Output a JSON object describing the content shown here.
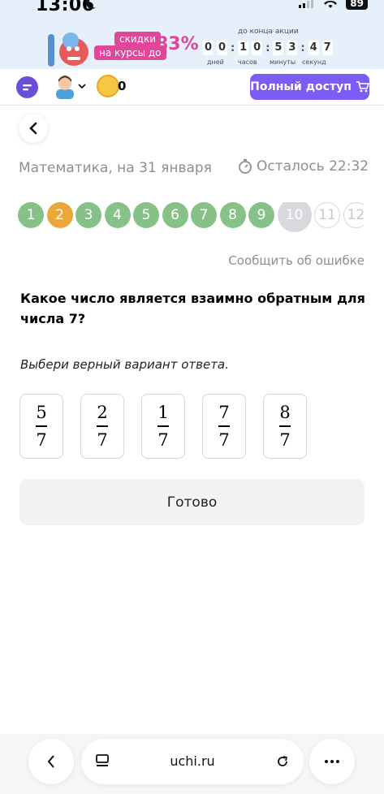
{
  "status": {
    "time": "13:06",
    "battery": "89"
  },
  "promo": {
    "pill1": "скидки",
    "pill2": "на курсы до",
    "percent": "83%",
    "caption": "до конца акции",
    "digits": [
      "0",
      "0",
      "1",
      "0",
      "5",
      "3",
      "4",
      "7"
    ],
    "labels": [
      "дней",
      "часов",
      "минуты",
      "секунд"
    ]
  },
  "topbar": {
    "coins": "0",
    "access_label": "Полный доступ"
  },
  "header": {
    "subject": "Математика, на 31 января",
    "time_left": "Осталось 22:32"
  },
  "steps": [
    {
      "label": "1",
      "state": "done"
    },
    {
      "label": "2",
      "state": "current"
    },
    {
      "label": "3",
      "state": "done"
    },
    {
      "label": "4",
      "state": "done"
    },
    {
      "label": "5",
      "state": "done"
    },
    {
      "label": "6",
      "state": "done"
    },
    {
      "label": "7",
      "state": "done"
    },
    {
      "label": "8",
      "state": "done"
    },
    {
      "label": "9",
      "state": "done"
    },
    {
      "label": "10",
      "state": "active"
    },
    {
      "label": "11",
      "state": "future"
    },
    {
      "label": "12",
      "state": "future"
    }
  ],
  "report_link": "Сообщить об ошибке",
  "question": "Какое число является взаимно обратным для числа 7?",
  "hint": "Выбери верный вариант ответа.",
  "options": [
    {
      "num": "5",
      "den": "7"
    },
    {
      "num": "2",
      "den": "7"
    },
    {
      "num": "1",
      "den": "7"
    },
    {
      "num": "7",
      "den": "7"
    },
    {
      "num": "8",
      "den": "7"
    }
  ],
  "ready_label": "Готово",
  "browser": {
    "url": "uchi.ru"
  }
}
